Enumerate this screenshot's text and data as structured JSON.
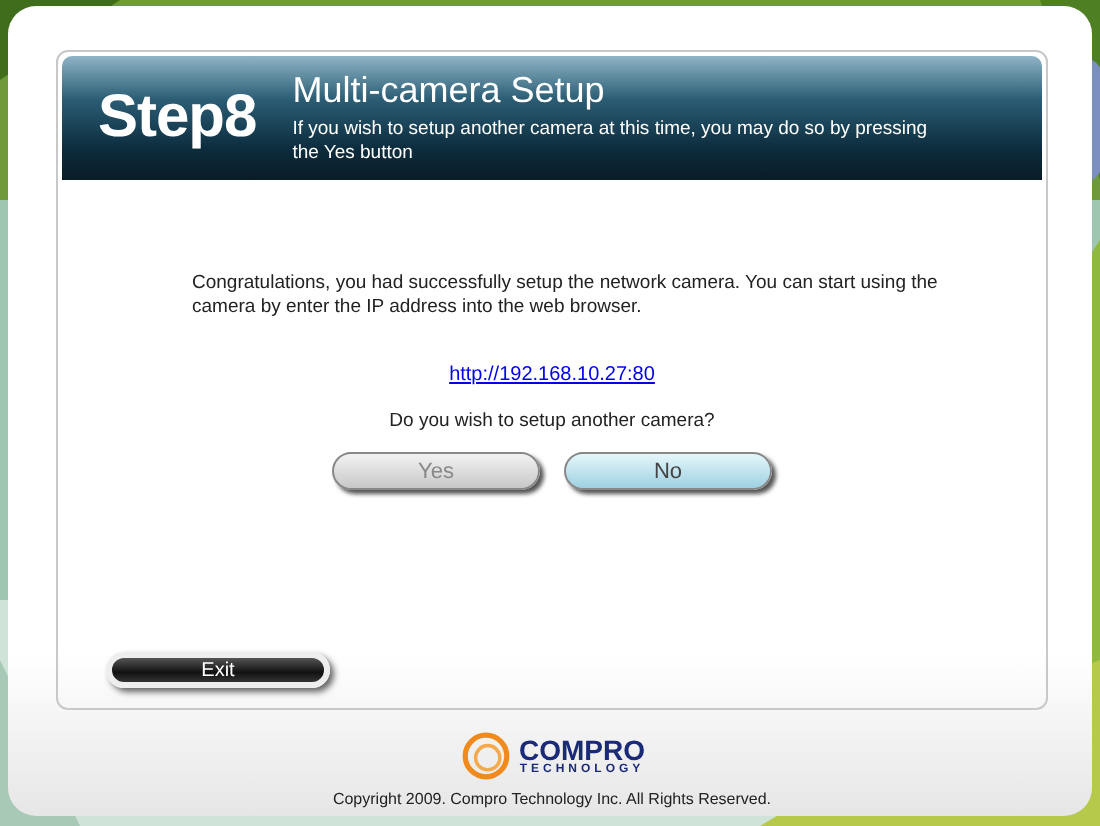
{
  "header": {
    "step": "Step8",
    "title": "Multi-camera Setup",
    "subtitle": "If you wish to setup another camera at this time, you may do so by pressing the Yes button"
  },
  "message": "Congratulations, you had successfully setup the network camera. You can start using the camera by enter the IP address into the web browser.",
  "link": "http://192.168.10.27:80",
  "question": "Do you wish to setup another camera?",
  "buttons": [
    {
      "label": "Yes",
      "disabled": true
    },
    {
      "label": "No",
      "disabled": false
    }
  ],
  "exit_button": "Exit",
  "logo": {
    "name": "COMPRO",
    "tagline": "TECHNOLOGY"
  },
  "copyright": "Copyright 2009. Compro Technology Inc. All Rights Reserved."
}
